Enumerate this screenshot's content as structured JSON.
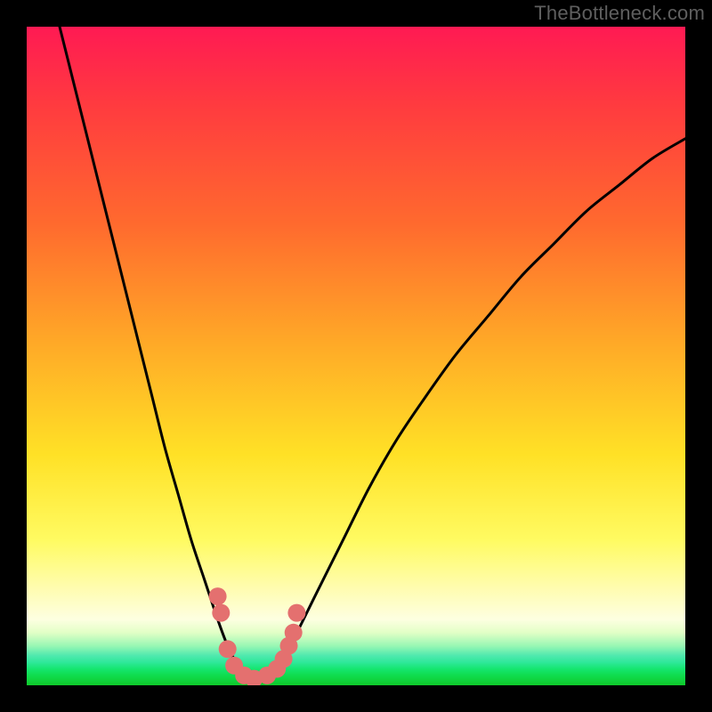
{
  "watermark": {
    "text": "TheBottleneck.com"
  },
  "chart_data": {
    "type": "line",
    "title": "",
    "xlabel": "",
    "ylabel": "",
    "xlim": [
      0,
      100
    ],
    "ylim": [
      0,
      100
    ],
    "grid": false,
    "legend": false,
    "annotations": [],
    "background_gradient": {
      "stops": [
        {
          "pos": 0,
          "color": "#ff1a53"
        },
        {
          "pos": 0.3,
          "color": "#ff6a2e"
        },
        {
          "pos": 0.65,
          "color": "#ffe126"
        },
        {
          "pos": 0.9,
          "color": "#fdffe1"
        },
        {
          "pos": 0.96,
          "color": "#2fe89a"
        },
        {
          "pos": 1.0,
          "color": "#0fc92a"
        }
      ]
    },
    "series": [
      {
        "name": "left-branch",
        "color": "#000000",
        "x": [
          5,
          7,
          9,
          11,
          13,
          15,
          17,
          19,
          21,
          23,
          25,
          27,
          29,
          30.5,
          32
        ],
        "y": [
          100,
          92,
          84,
          76,
          68,
          60,
          52,
          44,
          36,
          29,
          22,
          16,
          10,
          6,
          3
        ]
      },
      {
        "name": "right-branch",
        "color": "#000000",
        "x": [
          38,
          40,
          44,
          48,
          52,
          56,
          60,
          65,
          70,
          75,
          80,
          85,
          90,
          95,
          100
        ],
        "y": [
          3,
          6,
          14,
          22,
          30,
          37,
          43,
          50,
          56,
          62,
          67,
          72,
          76,
          80,
          83
        ]
      },
      {
        "name": "trough-floor",
        "color": "#000000",
        "x": [
          32,
          33.5,
          35,
          36.5,
          38
        ],
        "y": [
          3,
          1.5,
          1,
          1.5,
          3
        ]
      }
    ],
    "markers": [
      {
        "name": "trough-dots",
        "color": "#e4706f",
        "radius_percent": 1.35,
        "points": [
          {
            "x": 29.0,
            "y": 13.5
          },
          {
            "x": 29.5,
            "y": 11.0
          },
          {
            "x": 30.5,
            "y": 5.5
          },
          {
            "x": 31.5,
            "y": 3.0
          },
          {
            "x": 33.0,
            "y": 1.5
          },
          {
            "x": 34.5,
            "y": 1.0
          },
          {
            "x": 36.5,
            "y": 1.5
          },
          {
            "x": 38.0,
            "y": 2.5
          },
          {
            "x": 39.0,
            "y": 4.0
          },
          {
            "x": 39.8,
            "y": 6.0
          },
          {
            "x": 40.5,
            "y": 8.0
          },
          {
            "x": 41.0,
            "y": 11.0
          }
        ]
      }
    ]
  }
}
